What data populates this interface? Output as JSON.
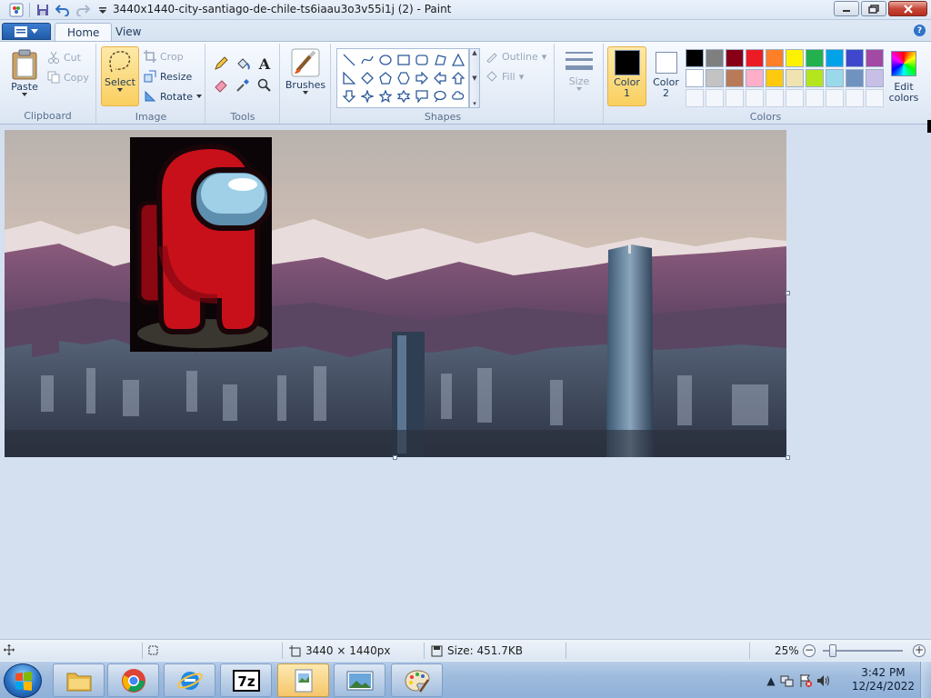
{
  "window": {
    "title": "3440x1440-city-santiago-de-chile-ts6iaau3o3v55i1j (2) - Paint"
  },
  "tabs": [
    {
      "label": "Home",
      "active": true
    },
    {
      "label": "View",
      "active": false
    }
  ],
  "ribbon": {
    "clipboard": {
      "label": "Clipboard",
      "paste": "Paste",
      "cut": "Cut",
      "copy": "Copy"
    },
    "image": {
      "label": "Image",
      "select": "Select",
      "crop": "Crop",
      "resize": "Resize",
      "rotate": "Rotate"
    },
    "tools": {
      "label": "Tools"
    },
    "brushes": {
      "label": "Brushes"
    },
    "shapes": {
      "label": "Shapes",
      "outline": "Outline",
      "fill": "Fill"
    },
    "size": {
      "label": "Size"
    },
    "colors": {
      "label": "Colors",
      "color1_line1": "Color",
      "color1_line2": "1",
      "color2_line1": "Color",
      "color2_line2": "2",
      "edit_line1": "Edit",
      "edit_line2": "colors",
      "color1_value": "#000000",
      "color2_value": "#ffffff",
      "palette_row1": [
        "#000000",
        "#7f7f7f",
        "#880015",
        "#ed1c24",
        "#ff7f27",
        "#fff200",
        "#22b14c",
        "#00a2e8",
        "#3f48cc",
        "#a349a4"
      ],
      "palette_row2": [
        "#ffffff",
        "#c3c3c3",
        "#b97a57",
        "#ffaec9",
        "#ffc90e",
        "#efe4b0",
        "#b5e61d",
        "#99d9ea",
        "#7092be",
        "#c8bfe7"
      ]
    }
  },
  "canvas": {
    "accent_sky": "#cdbfb4",
    "accent_mountain": "#7a4d74",
    "character_color": "#c8101b"
  },
  "status": {
    "dimensions": "3440 × 1440px",
    "size": "Size: 451.7KB",
    "zoom": "25%"
  },
  "taskbar": {
    "apps": [
      "file-explorer",
      "chrome",
      "ie",
      "7zip",
      "paint-folder",
      "image-viewer",
      "paint"
    ],
    "time": "3:42 PM",
    "date": "12/24/2022"
  }
}
